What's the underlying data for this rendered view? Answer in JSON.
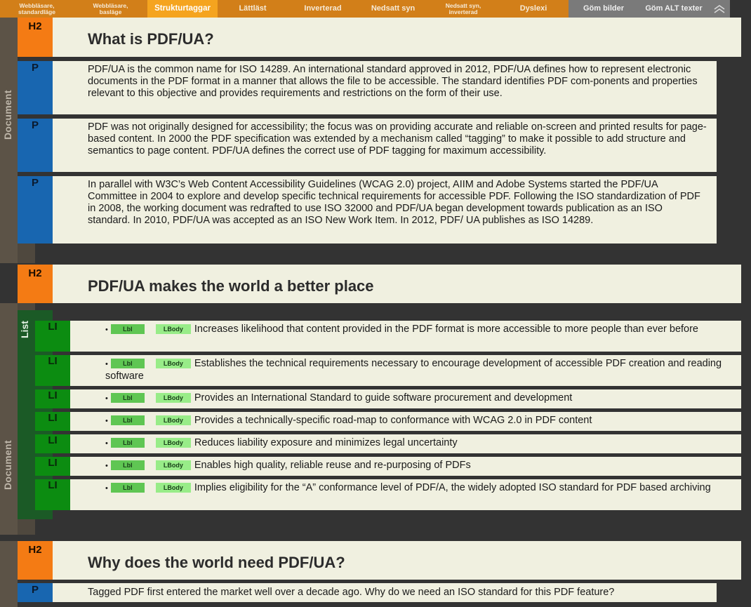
{
  "toolbar": {
    "buttons": [
      {
        "label": "Webbläsare,\nstandardläge",
        "style": "small",
        "width": 105
      },
      {
        "label": "Webbläsare,\nbasläge",
        "style": "small",
        "width": 105
      },
      {
        "label": "Strukturtaggar",
        "style": "active",
        "width": 100
      },
      {
        "label": "Lättläst",
        "style": "normal",
        "width": 100
      },
      {
        "label": "Inverterad",
        "style": "normal",
        "width": 100
      },
      {
        "label": "Nedsatt syn",
        "style": "normal",
        "width": 100
      },
      {
        "label": "Nedsatt syn,\ninverterad",
        "style": "small",
        "width": 100
      },
      {
        "label": "Dyslexi",
        "style": "normal",
        "width": 100
      },
      {
        "label": "Göm bilder",
        "style": "grey",
        "width": 100
      },
      {
        "label": "Göm ALT texter",
        "style": "grey",
        "width": 100
      }
    ],
    "collapse_icon": "double-chevron-up-icon"
  },
  "labels": {
    "document": "Document",
    "list": "List",
    "h2": "H2",
    "p": "P",
    "li": "LI",
    "lbl": "Lbl",
    "lbody": "LBody",
    "bullet": "•"
  },
  "sections": [
    {
      "heading": "What is PDF/UA?",
      "paragraphs": [
        "PDF/UA is the common name for ISO 14289. An international standard approved in 2012, PDF/UA defines how to represent electronic documents in the PDF format in a manner that allows the file to be accessible. The standard identifies PDF com-ponents and properties relevant to this objective and provides requirements and restrictions on the form of their use.",
        "PDF was not originally designed for accessibility; the focus was on providing accurate and reliable on-screen and printed results for page-based content. In 2000 the PDF specification was extended by a mechanism called “tagging” to make it possible to add structure and semantics to page content. PDF/UA defines the correct use of PDF tagging for maximum accessibility.",
        "In parallel with W3C’s Web Content Accessibility Guidelines (WCAG 2.0) project, AIIM and Adobe Systems started the PDF/UA Committee in 2004 to explore and develop specific technical requirements for accessible PDF. Following the ISO standardization of PDF in 2008, the working document was redrafted to use ISO 32000 and PDF/UA began development towards publication as an ISO standard. In 2010, PDF/UA was accepted as an ISO New Work Item. In 2012, PDF/ UA publishes as ISO 14289."
      ]
    },
    {
      "heading": "PDF/UA makes the world a better place",
      "list_items": [
        "Increases likelihood that content provided in the PDF format is more accessible to more people than ever before",
        "Establishes the technical requirements necessary to encourage development of accessible PDF creation and reading software",
        "Provides an International Standard to guide software procurement and development",
        "Provides a technically-specific road-map to conformance with WCAG 2.0 in PDF content",
        "Reduces liability exposure and minimizes legal uncertainty",
        "Enables high quality, reliable reuse and re-purposing of PDFs",
        "Implies eligibility for the “A” conformance level of PDF/A, the widely adopted ISO standard for PDF based archiving"
      ]
    },
    {
      "heading": "Why does the world need PDF/UA?",
      "paragraphs": [
        "Tagged PDF first entered the market well over a decade ago. Why do we need an ISO standard for this PDF feature?"
      ]
    }
  ],
  "colors": {
    "toolbar": "#d27f19",
    "toolbar_active": "#f5a41f",
    "toolbar_grey": "#7a7a7a",
    "h2_tag": "#f47b14",
    "p_tag": "#1866b0",
    "li_tag": "#0c8c11",
    "block_bg": "#f0f0e0",
    "page_bg": "#333333"
  }
}
